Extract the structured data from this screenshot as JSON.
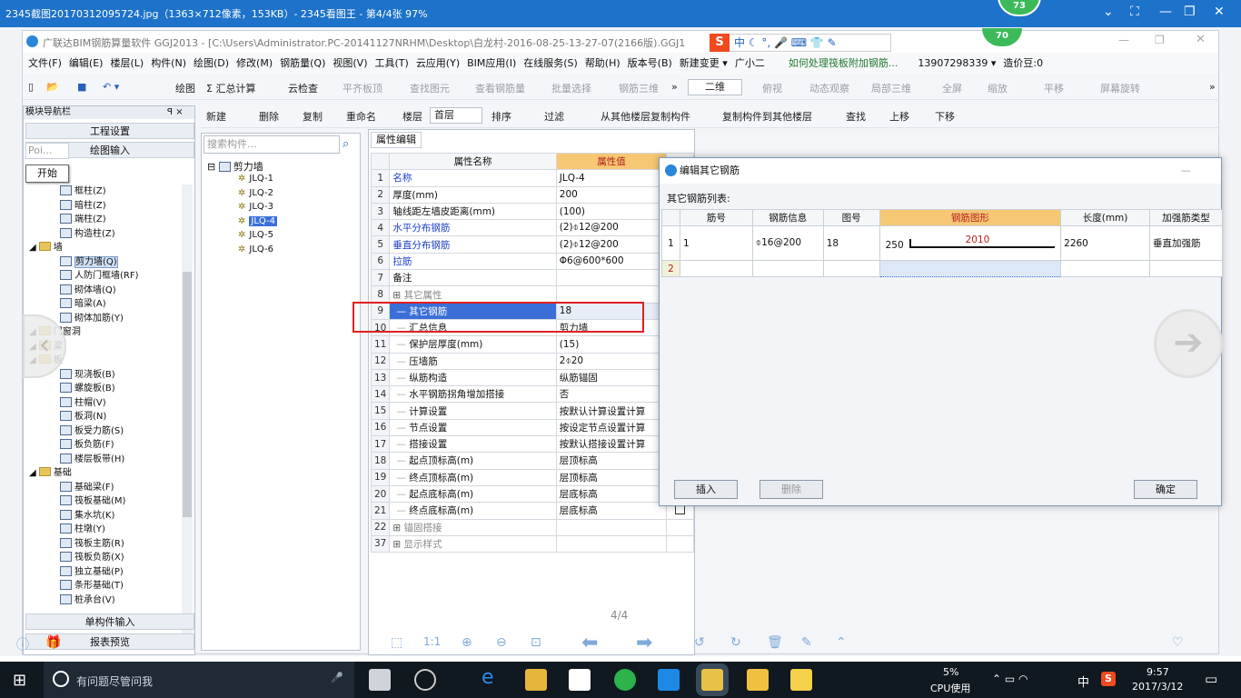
{
  "viewer": {
    "title": "2345截图20170312095724.jpg（1363×712像素，153KB）- 2345看图王 - 第4/4张 97%",
    "badge_top": "73",
    "page_counter": "4/4",
    "ratio_label": "1:1"
  },
  "app": {
    "title": "广联达BIM钢筋算量软件 GGJ2013 - [C:\\Users\\Administrator.PC-20141127NRHM\\Desktop\\白龙村-2016-08-25-13-27-07(2166版).GGJ1",
    "badge": "70",
    "menus": [
      "文件(F)",
      "编辑(E)",
      "楼层(L)",
      "构件(N)",
      "绘图(D)",
      "修改(M)",
      "钢筋量(Q)",
      "视图(V)",
      "工具(T)",
      "云应用(Y)",
      "BIM应用(I)",
      "在线服务(S)",
      "帮助(H)",
      "版本号(B)",
      "新建变更 ▾",
      "广小二",
      "如何处理筏板附加钢筋...",
      "13907298339 ▾",
      "造价豆:0"
    ],
    "toolbar1": [
      "绘图",
      "Σ 汇总计算",
      "云检查",
      "平齐板顶",
      "查找图元",
      "查看钢筋量",
      "批量选择",
      "钢筋三维",
      "二维",
      "俯视",
      "动态观察",
      "局部三维",
      "全屏",
      "缩放",
      "平移",
      "屏幕旋转"
    ],
    "toolbar2": [
      "新建",
      "删除",
      "复制",
      "重命名",
      "楼层",
      "首层",
      "排序",
      "过滤",
      "从其他楼层复制构件",
      "复制构件到其他楼层",
      "查找",
      "上移",
      "下移"
    ]
  },
  "nav": {
    "header": "模块导航栏",
    "pin": "ꟼ ×",
    "tab_project": "工程设置",
    "tab_draw": "绘图输入",
    "input_value": "Poi...",
    "start_button": "开始",
    "items": [
      {
        "label": "框柱(Z)",
        "level": 2,
        "type": "item"
      },
      {
        "label": "暗柱(Z)",
        "level": 2,
        "type": "item"
      },
      {
        "label": "端柱(Z)",
        "level": 2,
        "type": "item"
      },
      {
        "label": "构造柱(Z)",
        "level": 2,
        "type": "item"
      },
      {
        "label": "墙",
        "level": 1,
        "type": "folder"
      },
      {
        "label": "剪力墙(Q)",
        "level": 2,
        "type": "item",
        "selected": true
      },
      {
        "label": "人防门框墙(RF)",
        "level": 2,
        "type": "item"
      },
      {
        "label": "砌体墙(Q)",
        "level": 2,
        "type": "item"
      },
      {
        "label": "暗梁(A)",
        "level": 2,
        "type": "item"
      },
      {
        "label": "砌体加筋(Y)",
        "level": 2,
        "type": "item"
      },
      {
        "label": "门窗洞",
        "level": 1,
        "type": "folder"
      },
      {
        "label": "梁",
        "level": 1,
        "type": "folder"
      },
      {
        "label": "板",
        "level": 1,
        "type": "folder"
      },
      {
        "label": "现浇板(B)",
        "level": 2,
        "type": "item"
      },
      {
        "label": "螺旋板(B)",
        "level": 2,
        "type": "item"
      },
      {
        "label": "柱帽(V)",
        "level": 2,
        "type": "item"
      },
      {
        "label": "板洞(N)",
        "level": 2,
        "type": "item"
      },
      {
        "label": "板受力筋(S)",
        "level": 2,
        "type": "item"
      },
      {
        "label": "板负筋(F)",
        "level": 2,
        "type": "item"
      },
      {
        "label": "楼层板带(H)",
        "level": 2,
        "type": "item"
      },
      {
        "label": "基础",
        "level": 1,
        "type": "folder"
      },
      {
        "label": "基础梁(F)",
        "level": 2,
        "type": "item"
      },
      {
        "label": "筏板基础(M)",
        "level": 2,
        "type": "item"
      },
      {
        "label": "集水坑(K)",
        "level": 2,
        "type": "item"
      },
      {
        "label": "柱墩(Y)",
        "level": 2,
        "type": "item"
      },
      {
        "label": "筏板主筋(R)",
        "level": 2,
        "type": "item"
      },
      {
        "label": "筏板负筋(X)",
        "level": 2,
        "type": "item"
      },
      {
        "label": "独立基础(P)",
        "level": 2,
        "type": "item"
      },
      {
        "label": "条形基础(T)",
        "level": 2,
        "type": "item"
      },
      {
        "label": "桩承台(V)",
        "level": 2,
        "type": "item"
      }
    ],
    "bottom_single": "单构件输入",
    "bottom_report": "报表预览"
  },
  "complist": {
    "search_placeholder": "搜索构件...",
    "root": "剪力墙",
    "items": [
      "JLQ-1",
      "JLQ-2",
      "JLQ-3",
      "JLQ-4",
      "JLQ-5",
      "JLQ-6"
    ],
    "selected_index": 3
  },
  "prop": {
    "tab": "属性编辑",
    "col_name": "属性名称",
    "col_value": "属性值",
    "rows": [
      {
        "n": "1",
        "name": "名称",
        "value": "JLQ-4",
        "blue": true
      },
      {
        "n": "2",
        "name": "厚度(mm)",
        "value": "200"
      },
      {
        "n": "3",
        "name": "轴线距左墙皮距离(mm)",
        "value": "(100)"
      },
      {
        "n": "4",
        "name": "水平分布钢筋",
        "value": "(2)⌽12@200",
        "blue": true
      },
      {
        "n": "5",
        "name": "垂直分布钢筋",
        "value": "(2)⌽12@200",
        "blue": true
      },
      {
        "n": "6",
        "name": "拉筋",
        "value": "Φ6@600*600",
        "blue": true
      },
      {
        "n": "7",
        "name": "备注",
        "value": ""
      },
      {
        "n": "8",
        "name": "其它属性",
        "value": "",
        "group": true
      },
      {
        "n": "9",
        "name": "其它钢筋",
        "value": "18",
        "sub": true,
        "selected": true
      },
      {
        "n": "10",
        "name": "汇总信息",
        "value": "剪力墙",
        "sub": true
      },
      {
        "n": "11",
        "name": "保护层厚度(mm)",
        "value": "(15)",
        "sub": true
      },
      {
        "n": "12",
        "name": "压墙筋",
        "value": "2⌽20",
        "sub": true
      },
      {
        "n": "13",
        "name": "纵筋构造",
        "value": "纵筋锚固",
        "sub": true
      },
      {
        "n": "14",
        "name": "水平钢筋拐角增加搭接",
        "value": "否",
        "sub": true
      },
      {
        "n": "15",
        "name": "计算设置",
        "value": "按默认计算设置计算",
        "sub": true
      },
      {
        "n": "16",
        "name": "节点设置",
        "value": "按设定节点设置计算",
        "sub": true
      },
      {
        "n": "17",
        "name": "搭接设置",
        "value": "按默认搭接设置计算",
        "sub": true
      },
      {
        "n": "18",
        "name": "起点顶标高(m)",
        "value": "层顶标高",
        "sub": true
      },
      {
        "n": "19",
        "name": "终点顶标高(m)",
        "value": "层顶标高",
        "sub": true
      },
      {
        "n": "20",
        "name": "起点底标高(m)",
        "value": "层底标高",
        "sub": true
      },
      {
        "n": "21",
        "name": "终点底标高(m)",
        "value": "层底标高",
        "sub": true
      },
      {
        "n": "22",
        "name": "锚固搭接",
        "value": "",
        "group": true
      },
      {
        "n": "37",
        "name": "显示样式",
        "value": "",
        "group": true
      }
    ]
  },
  "dialog": {
    "title": "编辑其它钢筋",
    "list_label": "其它钢筋列表:",
    "headers": [
      "筋号",
      "钢筋信息",
      "图号",
      "钢筋图形",
      "长度(mm)",
      "加强筋类型"
    ],
    "rows": [
      {
        "n": "1",
        "bar_no": "1",
        "info": "⌽16@200",
        "fig": "18",
        "shape_left": "250",
        "shape_mid": "2010",
        "length": "2260",
        "type": "垂直加强筋"
      },
      {
        "n": "2",
        "bar_no": "",
        "info": "",
        "fig": "",
        "shape_left": "",
        "shape_mid": "",
        "length": "",
        "type": ""
      }
    ],
    "btn_insert": "插入",
    "btn_delete": "删除",
    "btn_ok": "确定"
  },
  "taskbar": {
    "search": "有问题尽管问我",
    "cpu_pct": "5%",
    "cpu_label": "CPU使用",
    "ime": "中",
    "time": "9:57",
    "date": "2017/3/12"
  },
  "colors": {
    "accent": "#1d72c9",
    "highlight_red": "#e02020",
    "header_orange": "#f7c873",
    "selected_blue": "#3a6fd8"
  }
}
